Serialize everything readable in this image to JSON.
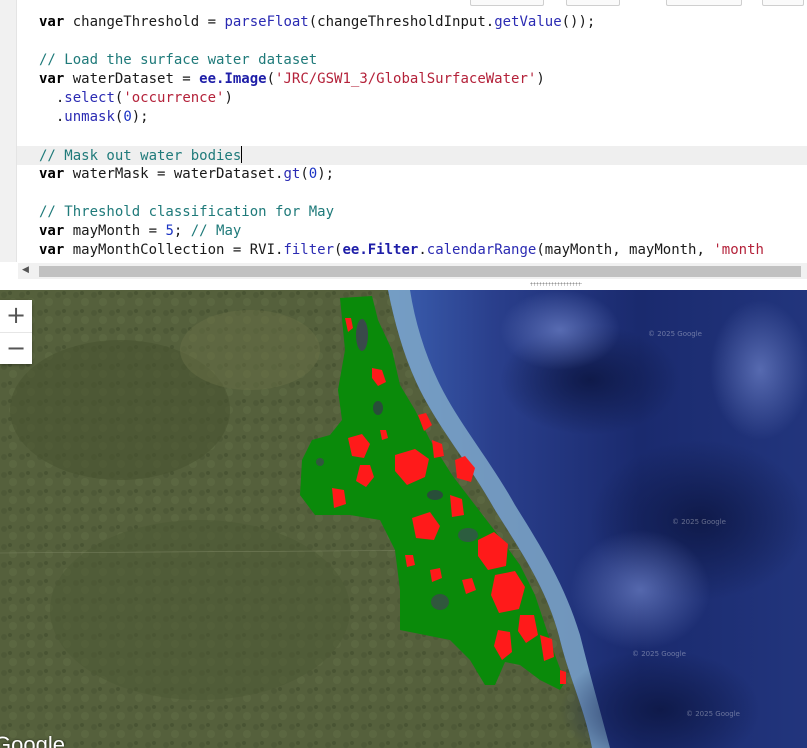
{
  "editor": {
    "lines": [
      {
        "row": 0,
        "parts": [
          [
            "kw",
            "var"
          ],
          [
            "t",
            " changeThreshold = "
          ],
          [
            "fn",
            "parseFloat"
          ],
          [
            "t",
            "(changeThresholdInput."
          ],
          [
            "fn",
            "getValue"
          ],
          [
            "t",
            "());"
          ]
        ]
      },
      {
        "row": 1,
        "parts": []
      },
      {
        "row": 2,
        "parts": [
          [
            "cm",
            "// Load the surface water dataset"
          ]
        ]
      },
      {
        "row": 3,
        "parts": [
          [
            "kw",
            "var"
          ],
          [
            "t",
            " waterDataset = "
          ],
          [
            "ee",
            "ee.Image"
          ],
          [
            "t",
            "("
          ],
          [
            "str",
            "'JRC/GSW1_3/GlobalSurfaceWater'"
          ],
          [
            "t",
            ")"
          ]
        ]
      },
      {
        "row": 4,
        "parts": [
          [
            "t",
            "  ."
          ],
          [
            "fn",
            "select"
          ],
          [
            "t",
            "("
          ],
          [
            "str",
            "'occurrence'"
          ],
          [
            "t",
            ")"
          ]
        ]
      },
      {
        "row": 5,
        "parts": [
          [
            "t",
            "  ."
          ],
          [
            "fn",
            "unmask"
          ],
          [
            "t",
            "("
          ],
          [
            "num",
            "0"
          ],
          [
            "t",
            ");"
          ]
        ]
      },
      {
        "row": 6,
        "parts": []
      },
      {
        "row": 7,
        "parts": [
          [
            "cm",
            "// Mask out water bodies"
          ],
          [
            "cursor",
            ""
          ]
        ]
      },
      {
        "row": 8,
        "parts": [
          [
            "kw",
            "var"
          ],
          [
            "t",
            " waterMask = waterDataset."
          ],
          [
            "fn",
            "gt"
          ],
          [
            "t",
            "("
          ],
          [
            "num",
            "0"
          ],
          [
            "t",
            ");"
          ]
        ]
      },
      {
        "row": 9,
        "parts": []
      },
      {
        "row": 10,
        "parts": [
          [
            "cm",
            "// Threshold classification for May"
          ]
        ]
      },
      {
        "row": 11,
        "parts": [
          [
            "kw",
            "var"
          ],
          [
            "t",
            " mayMonth = "
          ],
          [
            "num",
            "5"
          ],
          [
            "t",
            "; "
          ],
          [
            "cm",
            "// May"
          ]
        ]
      },
      {
        "row": 12,
        "parts": [
          [
            "kw",
            "var"
          ],
          [
            "t",
            " mayMonthCollection = RVI."
          ],
          [
            "fn",
            "filter"
          ],
          [
            "t",
            "("
          ],
          [
            "ee",
            "ee.Filter"
          ],
          [
            "t",
            "."
          ],
          [
            "fn",
            "calendarRange"
          ],
          [
            "t",
            "(mayMonth, mayMonth, "
          ],
          [
            "str",
            "'month"
          ]
        ]
      }
    ],
    "highlighted_row": 7,
    "scroll_left_arrow": "◀"
  },
  "map": {
    "zoom_in_label": "+",
    "zoom_out_label": "−",
    "google_logo_text": "Google",
    "watermark_text": "© 2025 Google",
    "colors": {
      "land": "#55603c",
      "land_dark": "#3f4a2b",
      "ocean_deep": "#1a2a6e",
      "ocean_mid": "#2e4a9c",
      "coast": "#7fa8c8",
      "classified_green": "#0a8a0a",
      "classified_red": "#ff1a1a"
    }
  }
}
